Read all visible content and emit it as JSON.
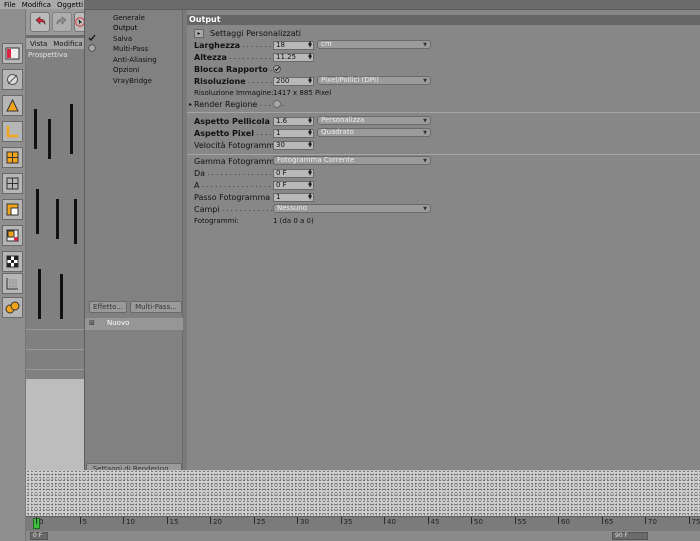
{
  "menubar": {
    "items": [
      "File",
      "Modifica",
      "Oggetti"
    ]
  },
  "viewport": {
    "menu_items": [
      "Vista",
      "Modifica",
      "Ca"
    ],
    "label": "Prospettiva"
  },
  "nav": {
    "items": [
      {
        "label": "Generale",
        "checked": false,
        "selected": false
      },
      {
        "label": "Output",
        "checked": false,
        "selected": true
      },
      {
        "label": "Salva",
        "checked": true,
        "selected": false
      },
      {
        "label": "Multi-Pass",
        "checked": false,
        "selected": false
      },
      {
        "label": "Anti-Aliasing",
        "checked": false,
        "selected": false
      },
      {
        "label": "Opzioni",
        "checked": false,
        "selected": false
      },
      {
        "label": "VrayBridge",
        "checked": false,
        "selected": false
      }
    ],
    "effect_button": "Effetto...",
    "multipass_button": "Multi-Pass...",
    "list_item": "Nuovo",
    "settings_button": "Settaggi di Rendering..."
  },
  "main": {
    "header": "Output",
    "preset_label": "Settaggi  Personalizzati",
    "width": {
      "label": "Larghezza",
      "value": "18",
      "unit": "cm"
    },
    "height": {
      "label": "Altezza",
      "value": "11.25"
    },
    "lock_ratio": {
      "label": "Blocca Rapporto",
      "checked": true
    },
    "resolution": {
      "label": "Risoluzione",
      "value": "200",
      "unit": "Pixel/Pollici (DPI)"
    },
    "image_resolution": {
      "label": "Risoluzione Immagine:",
      "value": "1417 x 885 Pixel"
    },
    "render_region": {
      "label": "Render Regione",
      "checked": false
    },
    "film_aspect": {
      "label": "Aspetto Pellicola",
      "value": "1.6",
      "option": "Personalizza"
    },
    "pixel_aspect": {
      "label": "Aspetto Pixel",
      "value": "1",
      "option": "Quadrato"
    },
    "frame_rate": {
      "label": "Velocità Fotogramma",
      "value": "30"
    },
    "frame_range": {
      "label": "Gamma Fotogramma",
      "option": "Fotogramma Corrente"
    },
    "from": {
      "label": "Da",
      "value": "0 F"
    },
    "to": {
      "label": "A",
      "value": "0 F"
    },
    "frame_step": {
      "label": "Passo Fotogramma",
      "value": "1"
    },
    "fields": {
      "label": "Campi",
      "option": "Nessuno"
    },
    "frames": {
      "label": "Fotogrammi:",
      "value": "1 (da 0 a 0)"
    }
  },
  "timeline": {
    "ticks": [
      "0",
      "5",
      "10",
      "15",
      "20",
      "25",
      "30",
      "35",
      "40",
      "45",
      "50",
      "55",
      "60",
      "65",
      "70",
      "75"
    ],
    "current_frame": 0,
    "start_field": "0 F",
    "end_field": "90 F"
  },
  "colors": {
    "accent_playhead": "#3fbf3f",
    "panel_bg": "#878787",
    "header_bg": "#666666"
  }
}
